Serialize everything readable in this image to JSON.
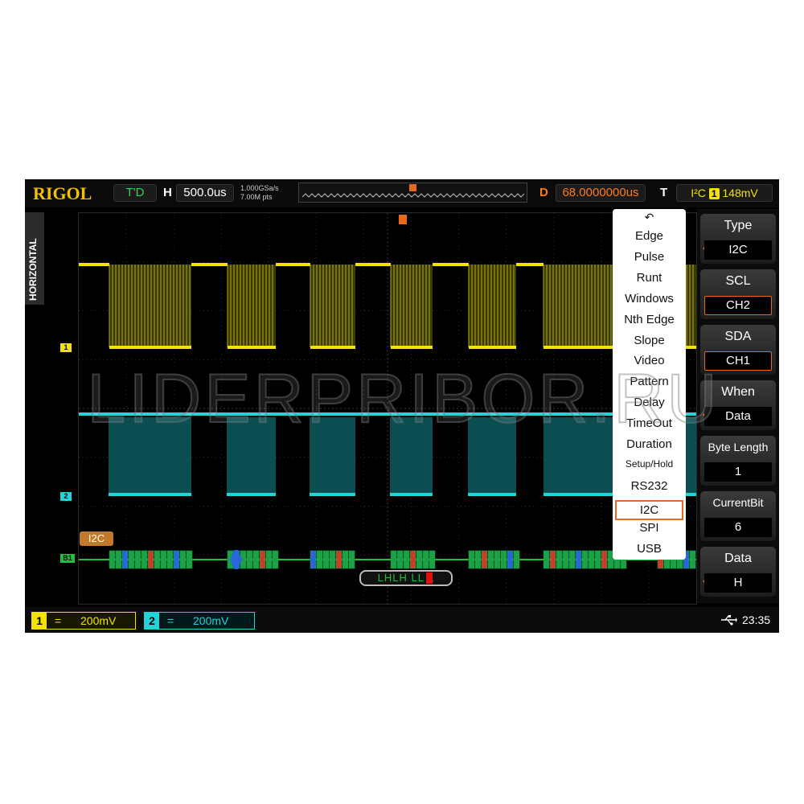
{
  "brand": "RIGOL",
  "run_status": "T'D",
  "horizontal": {
    "label": "H",
    "timebase": "500.0us",
    "sample_rate": "1.000GSa/s",
    "memory_depth": "7.00M pts"
  },
  "delay": {
    "label": "D",
    "value": "68.0000000us"
  },
  "trigger": {
    "label": "T",
    "source": "I²C",
    "channel": "1",
    "level": "148mV"
  },
  "side_tab": "HORIZONTAL",
  "channel_markers": {
    "ch1": "1",
    "ch2": "2",
    "bus": "B1"
  },
  "bus_label": "I2C",
  "bus_search": "LHLH LL L",
  "trigger_menu": {
    "items": [
      "Edge",
      "Pulse",
      "Runt",
      "Windows",
      "Nth Edge",
      "Slope",
      "Video",
      "Pattern",
      "Delay",
      "TimeOut",
      "Duration",
      "Setup/Hold",
      "RS232",
      "I2C",
      "SPI",
      "USB"
    ],
    "selected": "I2C"
  },
  "softkeys": {
    "type": {
      "title": "Type",
      "value": "I2C"
    },
    "scl": {
      "title": "SCL",
      "value": "CH2"
    },
    "sda": {
      "title": "SDA",
      "value": "CH1"
    },
    "when": {
      "title": "When",
      "value": "Data"
    },
    "byte_length": {
      "title": "Byte Length",
      "value": "1"
    },
    "current_bit": {
      "title": "CurrentBit",
      "value": "6"
    },
    "data": {
      "title": "Data",
      "value": "H"
    }
  },
  "bottom": {
    "ch1": {
      "num": "1",
      "coupling": "=",
      "scale": "200mV"
    },
    "ch2": {
      "num": "2",
      "coupling": "=",
      "scale": "200mV"
    },
    "time": "23:35"
  },
  "watermark": "LIDERPRIBOR.RU",
  "colors": {
    "ch1": "#f2e400",
    "ch2": "#22d3d8",
    "bus": "#1fc03c",
    "accent": "#e8691a"
  }
}
